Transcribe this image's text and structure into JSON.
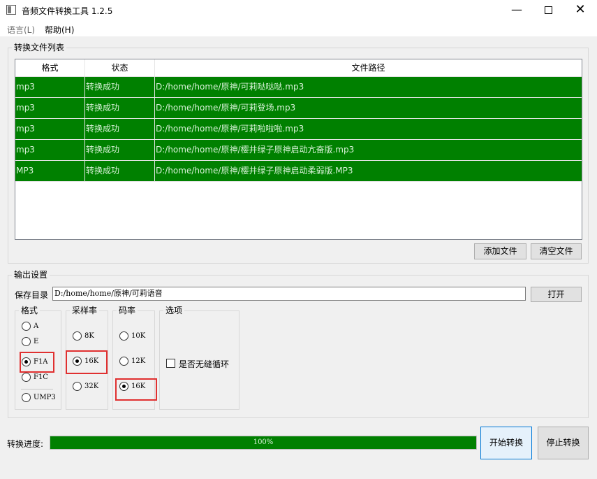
{
  "window": {
    "title": "音频文件转换工具 1.2.5",
    "minimize": "—",
    "close": "✕"
  },
  "menu": {
    "language": "语言(L)",
    "help": "帮助(H)"
  },
  "file_list": {
    "group_title": "转换文件列表",
    "columns": [
      "格式",
      "状态",
      "文件路径"
    ],
    "rows": [
      {
        "format": "mp3",
        "status": "转换成功",
        "path": "D:/home/home/原神/可莉哒哒哒.mp3"
      },
      {
        "format": "mp3",
        "status": "转换成功",
        "path": "D:/home/home/原神/可莉登场.mp3"
      },
      {
        "format": "mp3",
        "status": "转换成功",
        "path": "D:/home/home/原神/可莉啦啦啦.mp3"
      },
      {
        "format": "mp3",
        "status": "转换成功",
        "path": "D:/home/home/原神/樱井绿子原神启动亢奋版.mp3"
      },
      {
        "format": "MP3",
        "status": "转换成功",
        "path": "D:/home/home/原神/樱井绿子原神启动柔弱版.MP3"
      }
    ],
    "row_color": "#008000",
    "add_button": "添加文件",
    "clear_button": "清空文件"
  },
  "output": {
    "group_title": "输出设置",
    "save_dir_label": "保存目录",
    "save_dir_value": "D:/home/home/原神/可莉语音",
    "open_button": "打开",
    "format": {
      "title": "格式",
      "options": [
        "A",
        "E",
        "F1A",
        "F1C",
        "UMP3"
      ],
      "selected": "F1A"
    },
    "sample_rate": {
      "title": "采样率",
      "options": [
        "8K",
        "16K",
        "32K"
      ],
      "selected": "16K"
    },
    "bitrate": {
      "title": "码率",
      "options": [
        "10K",
        "12K",
        "16K"
      ],
      "selected": "16K"
    },
    "options": {
      "title": "选项",
      "seamless_loop_label": "是否无缝循环",
      "seamless_loop_checked": false
    }
  },
  "progress": {
    "label": "转换进度:",
    "value_percent": 100,
    "text": "100%"
  },
  "actions": {
    "start": "开始转换",
    "stop": "停止转换"
  }
}
